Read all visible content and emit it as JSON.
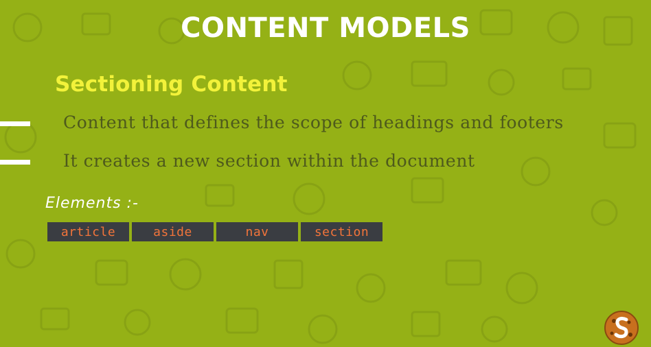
{
  "slide": {
    "title": "CONTENT MODELS",
    "subtitle": "Sectioning Content",
    "bullets": [
      "Content that defines the scope of headings and footers",
      "It creates a new section within the document"
    ],
    "elements_label": "Elements :-",
    "tags": [
      "article",
      "aside",
      "nav",
      "section"
    ],
    "logo_icon": "cookie-s-logo-icon"
  },
  "colors": {
    "background": "#95b116",
    "title": "#ffffff",
    "subtitle": "#f2f23a",
    "bullet_text": "#4e5a1c",
    "tag_bg": "#3a3d42",
    "tag_text": "#f2743a"
  }
}
